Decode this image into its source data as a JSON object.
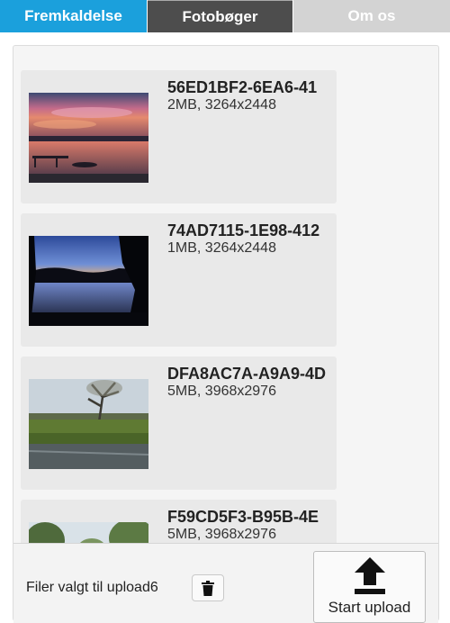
{
  "tabs": [
    {
      "label": "Fremkaldelse"
    },
    {
      "label": "Fotobøger"
    },
    {
      "label": "Om os"
    }
  ],
  "files": [
    {
      "name": "56ED1BF2-6EA6-41",
      "meta": "2MB, 3264x2448",
      "scene": "sunset lake with dock"
    },
    {
      "name": "74AD7115-1E98-412",
      "meta": "1MB, 3264x2448",
      "scene": "dusk lake silhouette"
    },
    {
      "name": "DFA8AC7A-A9A9-4D",
      "meta": "5MB, 3968x2976",
      "scene": "tree by pond"
    },
    {
      "name": "F59CD5F3-B95B-4E",
      "meta": "5MB, 3968x2976",
      "scene": "trees and sky"
    }
  ],
  "footer": {
    "selected_label": "Filer valgt til upload6",
    "upload_label": "Start upload"
  },
  "colors": {
    "tab_active": "#1ba0dc",
    "tab_dark": "#4d4d4d",
    "tab_light": "#d3d3d3"
  }
}
